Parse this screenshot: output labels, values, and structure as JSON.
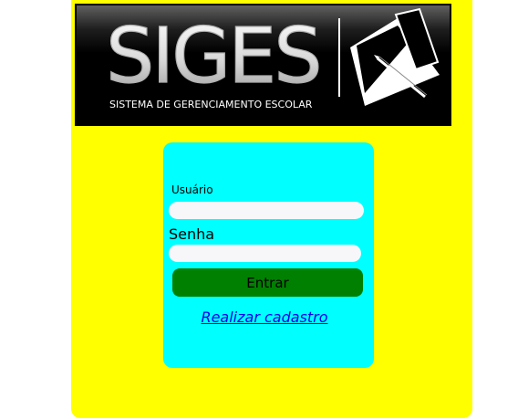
{
  "header": {
    "logo_title": "SIGES",
    "logo_subtitle": "SISTEMA DE GERENCIAMENTO ESCOLAR"
  },
  "login": {
    "user_label": "Usuário",
    "user_value": "",
    "password_label": "Senha",
    "password_value": "",
    "submit_label": "Entrar",
    "register_link": "Realizar cadastro"
  },
  "colors": {
    "page_background": "#ffff00",
    "card_background": "#00ffff",
    "button_background": "#008000",
    "link_color": "#0000ee",
    "banner_background": "#000000"
  },
  "icons": {
    "logo_emblem": "book-and-pen-icon"
  }
}
